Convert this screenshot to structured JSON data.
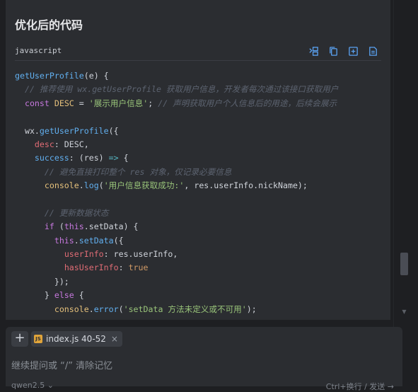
{
  "section_title": "优化后的代码",
  "code_block": {
    "language": "javascript",
    "actions": [
      "insert-icon",
      "copy-icon",
      "new-file-icon",
      "apply-icon"
    ],
    "lines": [
      [
        [
          "t-fn",
          "getUserProfile"
        ],
        [
          "t-pl",
          "(e) {"
        ]
      ],
      [
        [
          "t-pl",
          "  "
        ],
        [
          "t-cm",
          "// 推荐使用 wx.getUserProfile 获取用户信息，开发者每次通过该接口获取用户"
        ]
      ],
      [
        [
          "t-pl",
          "  "
        ],
        [
          "t-kw",
          "const "
        ],
        [
          "t-const",
          "DESC"
        ],
        [
          "t-pl",
          " = "
        ],
        [
          "t-str",
          "'展示用户信息'"
        ],
        [
          "t-pl",
          "; "
        ],
        [
          "t-cm",
          "// 声明获取用户个人信息后的用途，后续会展示"
        ]
      ],
      [
        [
          "t-pl",
          ""
        ]
      ],
      [
        [
          "t-pl",
          "  wx."
        ],
        [
          "t-fn",
          "getUserProfile"
        ],
        [
          "t-pl",
          "({"
        ]
      ],
      [
        [
          "t-pl",
          "    "
        ],
        [
          "t-prop",
          "desc"
        ],
        [
          "t-pl",
          ": DESC,"
        ]
      ],
      [
        [
          "t-pl",
          "    "
        ],
        [
          "t-fn",
          "success"
        ],
        [
          "t-pl",
          ": (res) "
        ],
        [
          "t-op",
          "=>"
        ],
        [
          "t-pl",
          " {"
        ]
      ],
      [
        [
          "t-pl",
          "      "
        ],
        [
          "t-cm",
          "// 避免直接打印整个 res 对象，仅记录必要信息"
        ]
      ],
      [
        [
          "t-pl",
          "      "
        ],
        [
          "t-const",
          "console"
        ],
        [
          "t-pl",
          "."
        ],
        [
          "t-fn",
          "log"
        ],
        [
          "t-pl",
          "("
        ],
        [
          "t-str",
          "'用户信息获取成功:'"
        ],
        [
          "t-pl",
          ", res.userInfo.nickName);"
        ]
      ],
      [
        [
          "t-pl",
          ""
        ]
      ],
      [
        [
          "t-pl",
          "      "
        ],
        [
          "t-cm",
          "// 更新数据状态"
        ]
      ],
      [
        [
          "t-pl",
          "      "
        ],
        [
          "t-kw",
          "if"
        ],
        [
          "t-pl",
          " ("
        ],
        [
          "t-kw",
          "this"
        ],
        [
          "t-pl",
          ".setData) {"
        ]
      ],
      [
        [
          "t-pl",
          "        "
        ],
        [
          "t-kw",
          "this"
        ],
        [
          "t-pl",
          "."
        ],
        [
          "t-fn",
          "setData"
        ],
        [
          "t-pl",
          "({"
        ]
      ],
      [
        [
          "t-pl",
          "          "
        ],
        [
          "t-prop",
          "userInfo"
        ],
        [
          "t-pl",
          ": res.userInfo,"
        ]
      ],
      [
        [
          "t-pl",
          "          "
        ],
        [
          "t-prop",
          "hasUserInfo"
        ],
        [
          "t-pl",
          ": "
        ],
        [
          "t-bool",
          "true"
        ]
      ],
      [
        [
          "t-pl",
          "        });"
        ]
      ],
      [
        [
          "t-pl",
          "      } "
        ],
        [
          "t-kw",
          "else"
        ],
        [
          "t-pl",
          " {"
        ]
      ],
      [
        [
          "t-pl",
          "        "
        ],
        [
          "t-const",
          "console"
        ],
        [
          "t-pl",
          "."
        ],
        [
          "t-fn",
          "error"
        ],
        [
          "t-pl",
          "("
        ],
        [
          "t-str",
          "'setData 方法未定义或不可用'"
        ],
        [
          "t-pl",
          ");"
        ]
      ]
    ]
  },
  "composer": {
    "file_chip_badge": "JS",
    "file_chip_label": "index.js 40-52",
    "placeholder": "继续提问或 “/” 清除记忆",
    "model": "qwen2.5 ⌄",
    "send_hint": "Ctrl+换行 / 发送 →"
  },
  "colors": {
    "accent": "#5aa2f2",
    "js_badge": "#e0a43a"
  }
}
